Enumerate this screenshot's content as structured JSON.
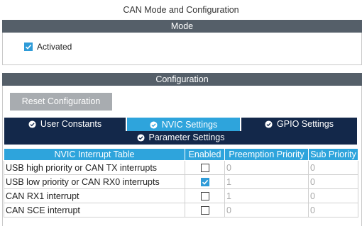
{
  "window": {
    "title": "CAN Mode and Configuration"
  },
  "mode": {
    "header": "Mode",
    "activated": {
      "label": "Activated",
      "checked": true
    }
  },
  "configuration": {
    "header": "Configuration",
    "reset_label": "Reset Configuration",
    "tabs": [
      {
        "label": "User Constants",
        "active": false
      },
      {
        "label": "NVIC Settings",
        "active": true
      },
      {
        "label": "GPIO Settings",
        "active": false
      },
      {
        "label": "Parameter Settings",
        "active": false
      }
    ],
    "table": {
      "headers": [
        "NVIC Interrupt Table",
        "Enabled",
        "Preemption Priority",
        "Sub Priority"
      ],
      "rows": [
        {
          "name": "USB high priority or CAN TX interrupts",
          "enabled": false,
          "preemption": "0",
          "sub": "0"
        },
        {
          "name": "USB low priority or CAN RX0 interrupts",
          "enabled": true,
          "preemption": "1",
          "sub": "0"
        },
        {
          "name": "CAN RX1 interrupt",
          "enabled": false,
          "preemption": "1",
          "sub": "0"
        },
        {
          "name": "CAN SCE interrupt",
          "enabled": false,
          "preemption": "0",
          "sub": "0"
        }
      ]
    }
  },
  "colors": {
    "section_bar": "#555f69",
    "tab_inactive": "#13284a",
    "tab_active": "#2ea4dc",
    "checkbox_checked": "#2e9bd8"
  },
  "icons": {
    "tab_status": "check-circle-icon",
    "checkbox_check": "checkmark-icon"
  }
}
